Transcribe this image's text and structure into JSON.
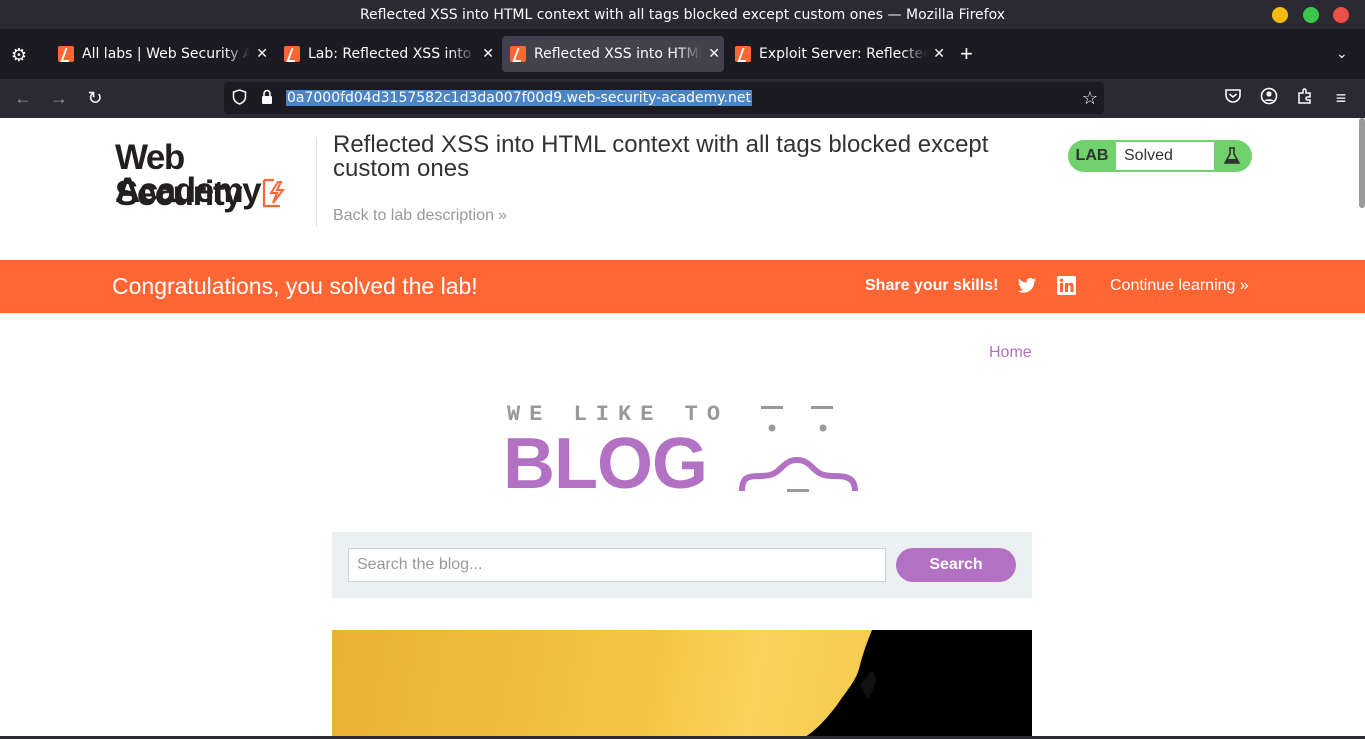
{
  "window": {
    "title": "Reflected XSS into HTML context with all tags blocked except custom ones — Mozilla Firefox"
  },
  "tabs": [
    {
      "label": "All labs | Web Security Academy",
      "active": false
    },
    {
      "label": "Lab: Reflected XSS into HTML context with all tags blocked except custom ones",
      "active": false
    },
    {
      "label": "Reflected XSS into HTML context with all tags blocked except custom ones",
      "active": true
    },
    {
      "label": "Exploit Server: Reflected XSS into HTML context with all tags blocked except custom ones",
      "active": false
    }
  ],
  "toolbar": {
    "url": "0a7000fd04d3157582c1d3da007f00d9.web-security-academy.net"
  },
  "lab": {
    "logo_line1": "Web Security",
    "logo_line2": "Academy",
    "title": "Reflected XSS into HTML context with all tags blocked except custom ones",
    "back_link": "Back to lab description",
    "status_label": "LAB",
    "status_value": "Solved",
    "status_color": "#70d16d"
  },
  "banner": {
    "message": "Congratulations, you solved the lab!",
    "share": "Share your skills!",
    "continue": "Continue learning",
    "color": "#ff6633"
  },
  "blog": {
    "home_link": "Home",
    "logo_tagline": "WE LIKE TO",
    "logo_word": "BLOG",
    "search_placeholder": "Search the blog...",
    "search_button": "Search",
    "accent": "#b271c2"
  }
}
